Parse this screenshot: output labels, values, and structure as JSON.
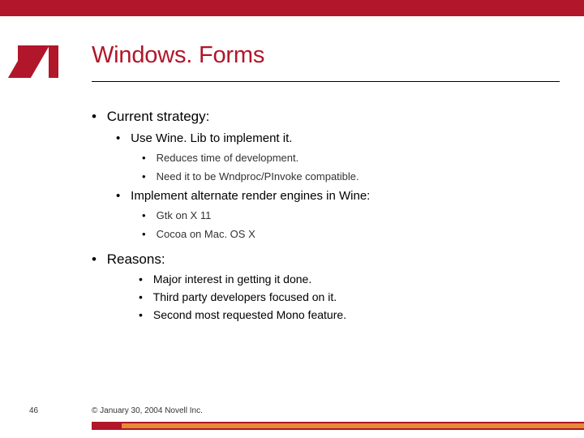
{
  "title": "Windows. Forms",
  "bullets": {
    "current_strategy": "Current strategy:",
    "use_winelib": "Use Wine. Lib to implement it.",
    "reduces_time": "Reduces time of development.",
    "need_wndproc": "Need it to be Wndproc/PInvoke compatible.",
    "implement_alt": "Implement alternate render engines in Wine:",
    "gtk": "Gtk on X 11",
    "cocoa": "Cocoa on Mac. OS X",
    "reasons": "Reasons:",
    "major_interest": "Major interest in getting it done.",
    "third_party": "Third party developers focused on it.",
    "second_most": "Second most requested Mono feature."
  },
  "footer": {
    "page": "46",
    "copyright": "© January 30, 2004 Novell Inc."
  },
  "brand_color": "#B1162A"
}
